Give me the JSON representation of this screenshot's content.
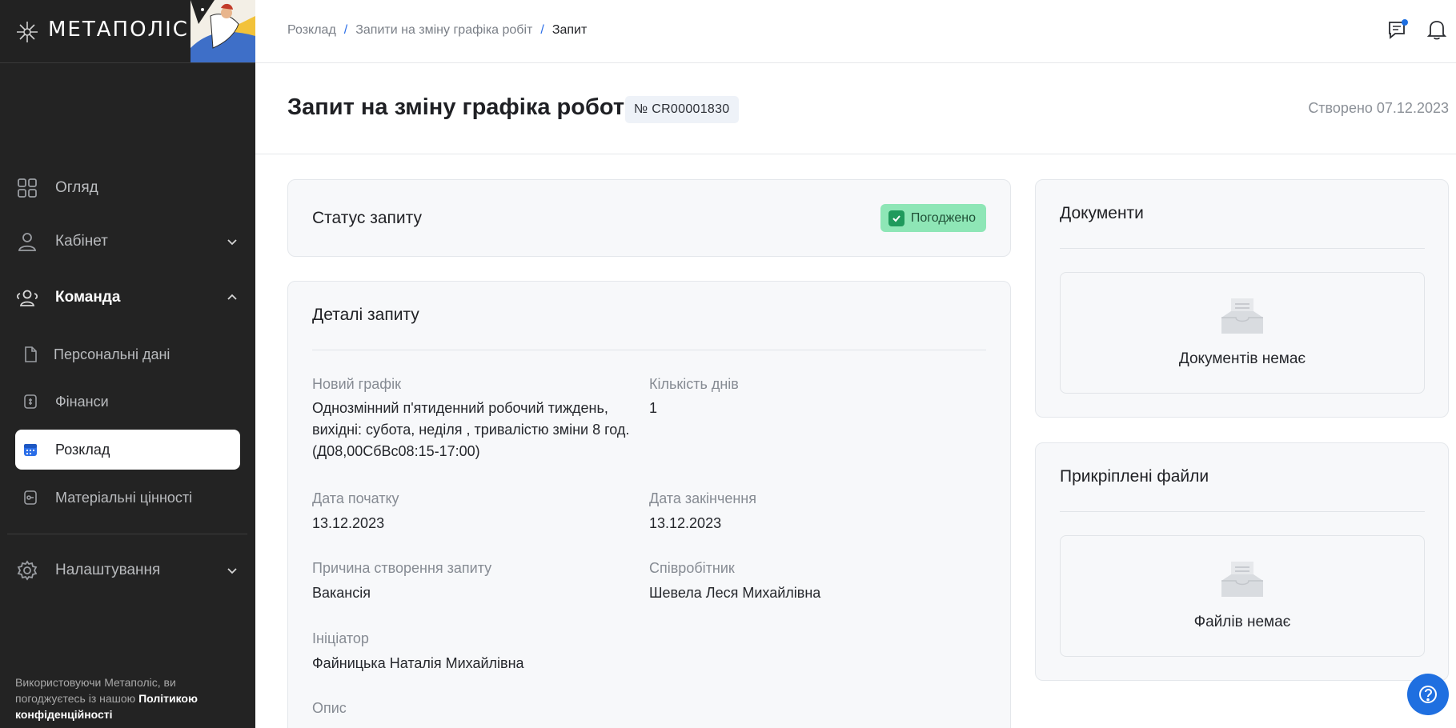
{
  "app": {
    "logo_text": "МЕТАПОЛІС"
  },
  "sidebar": {
    "items": [
      {
        "label": "Огляд",
        "icon": "grid-icon"
      },
      {
        "label": "Кабінет",
        "icon": "user-icon"
      },
      {
        "label": "Команда",
        "icon": "team-icon"
      },
      {
        "label": "Налаштування",
        "icon": "gear-icon"
      }
    ],
    "sub_items": [
      {
        "label": "Персональні дані",
        "icon": "document-icon"
      },
      {
        "label": "Фінанси",
        "icon": "finance-icon"
      },
      {
        "label": "Розклад",
        "icon": "calendar-icon",
        "active": true
      },
      {
        "label": "Матеріальні цінності",
        "icon": "assets-icon"
      }
    ],
    "footer_text": "Використовуючи Метаполіс, ви погоджуєтесь із нашою",
    "footer_link": "Політикою конфіденційності"
  },
  "breadcrumb": {
    "items": [
      "Розклад",
      "Запити на зміну графіка робіт",
      "Запит"
    ],
    "separator": "/"
  },
  "header": {
    "title": "Запит на зміну графіка роботи",
    "request_number": "№ CR00001830",
    "created": "Створено 07.12.2023"
  },
  "status_card": {
    "title": "Статус запиту",
    "status": "Погоджено",
    "status_color": "#8ee6b6"
  },
  "details": {
    "title": "Деталі запиту",
    "new_schedule_label": "Новий графік",
    "new_schedule_value": "Однозмінний п'ятиденний робочий тиждень, вихідні: субота, неділя , тривалістю зміни 8 год. (Д08,00СбВс08:15-17:00)",
    "days_label": "Кількість днів",
    "days_value": "1",
    "start_label": "Дата початку",
    "start_value": "13.12.2023",
    "end_label": "Дата закінчення",
    "end_value": "13.12.2023",
    "reason_label": "Причина створення запиту",
    "reason_value": "Вакансія",
    "employee_label": "Співробітник",
    "employee_value": "Шевела Леся Михайлівна",
    "initiator_label": "Ініціатор",
    "initiator_value": "Файницька Наталія Михайлівна",
    "description_label": "Опис"
  },
  "documents": {
    "title": "Документи",
    "empty_text": "Документів немає"
  },
  "attachments": {
    "title": "Прикріплені файли",
    "empty_text": "Файлів немає"
  },
  "colors": {
    "accent": "#1f6fe0",
    "sidebar_bg": "#232323",
    "status_bg": "#8ee6b6"
  }
}
